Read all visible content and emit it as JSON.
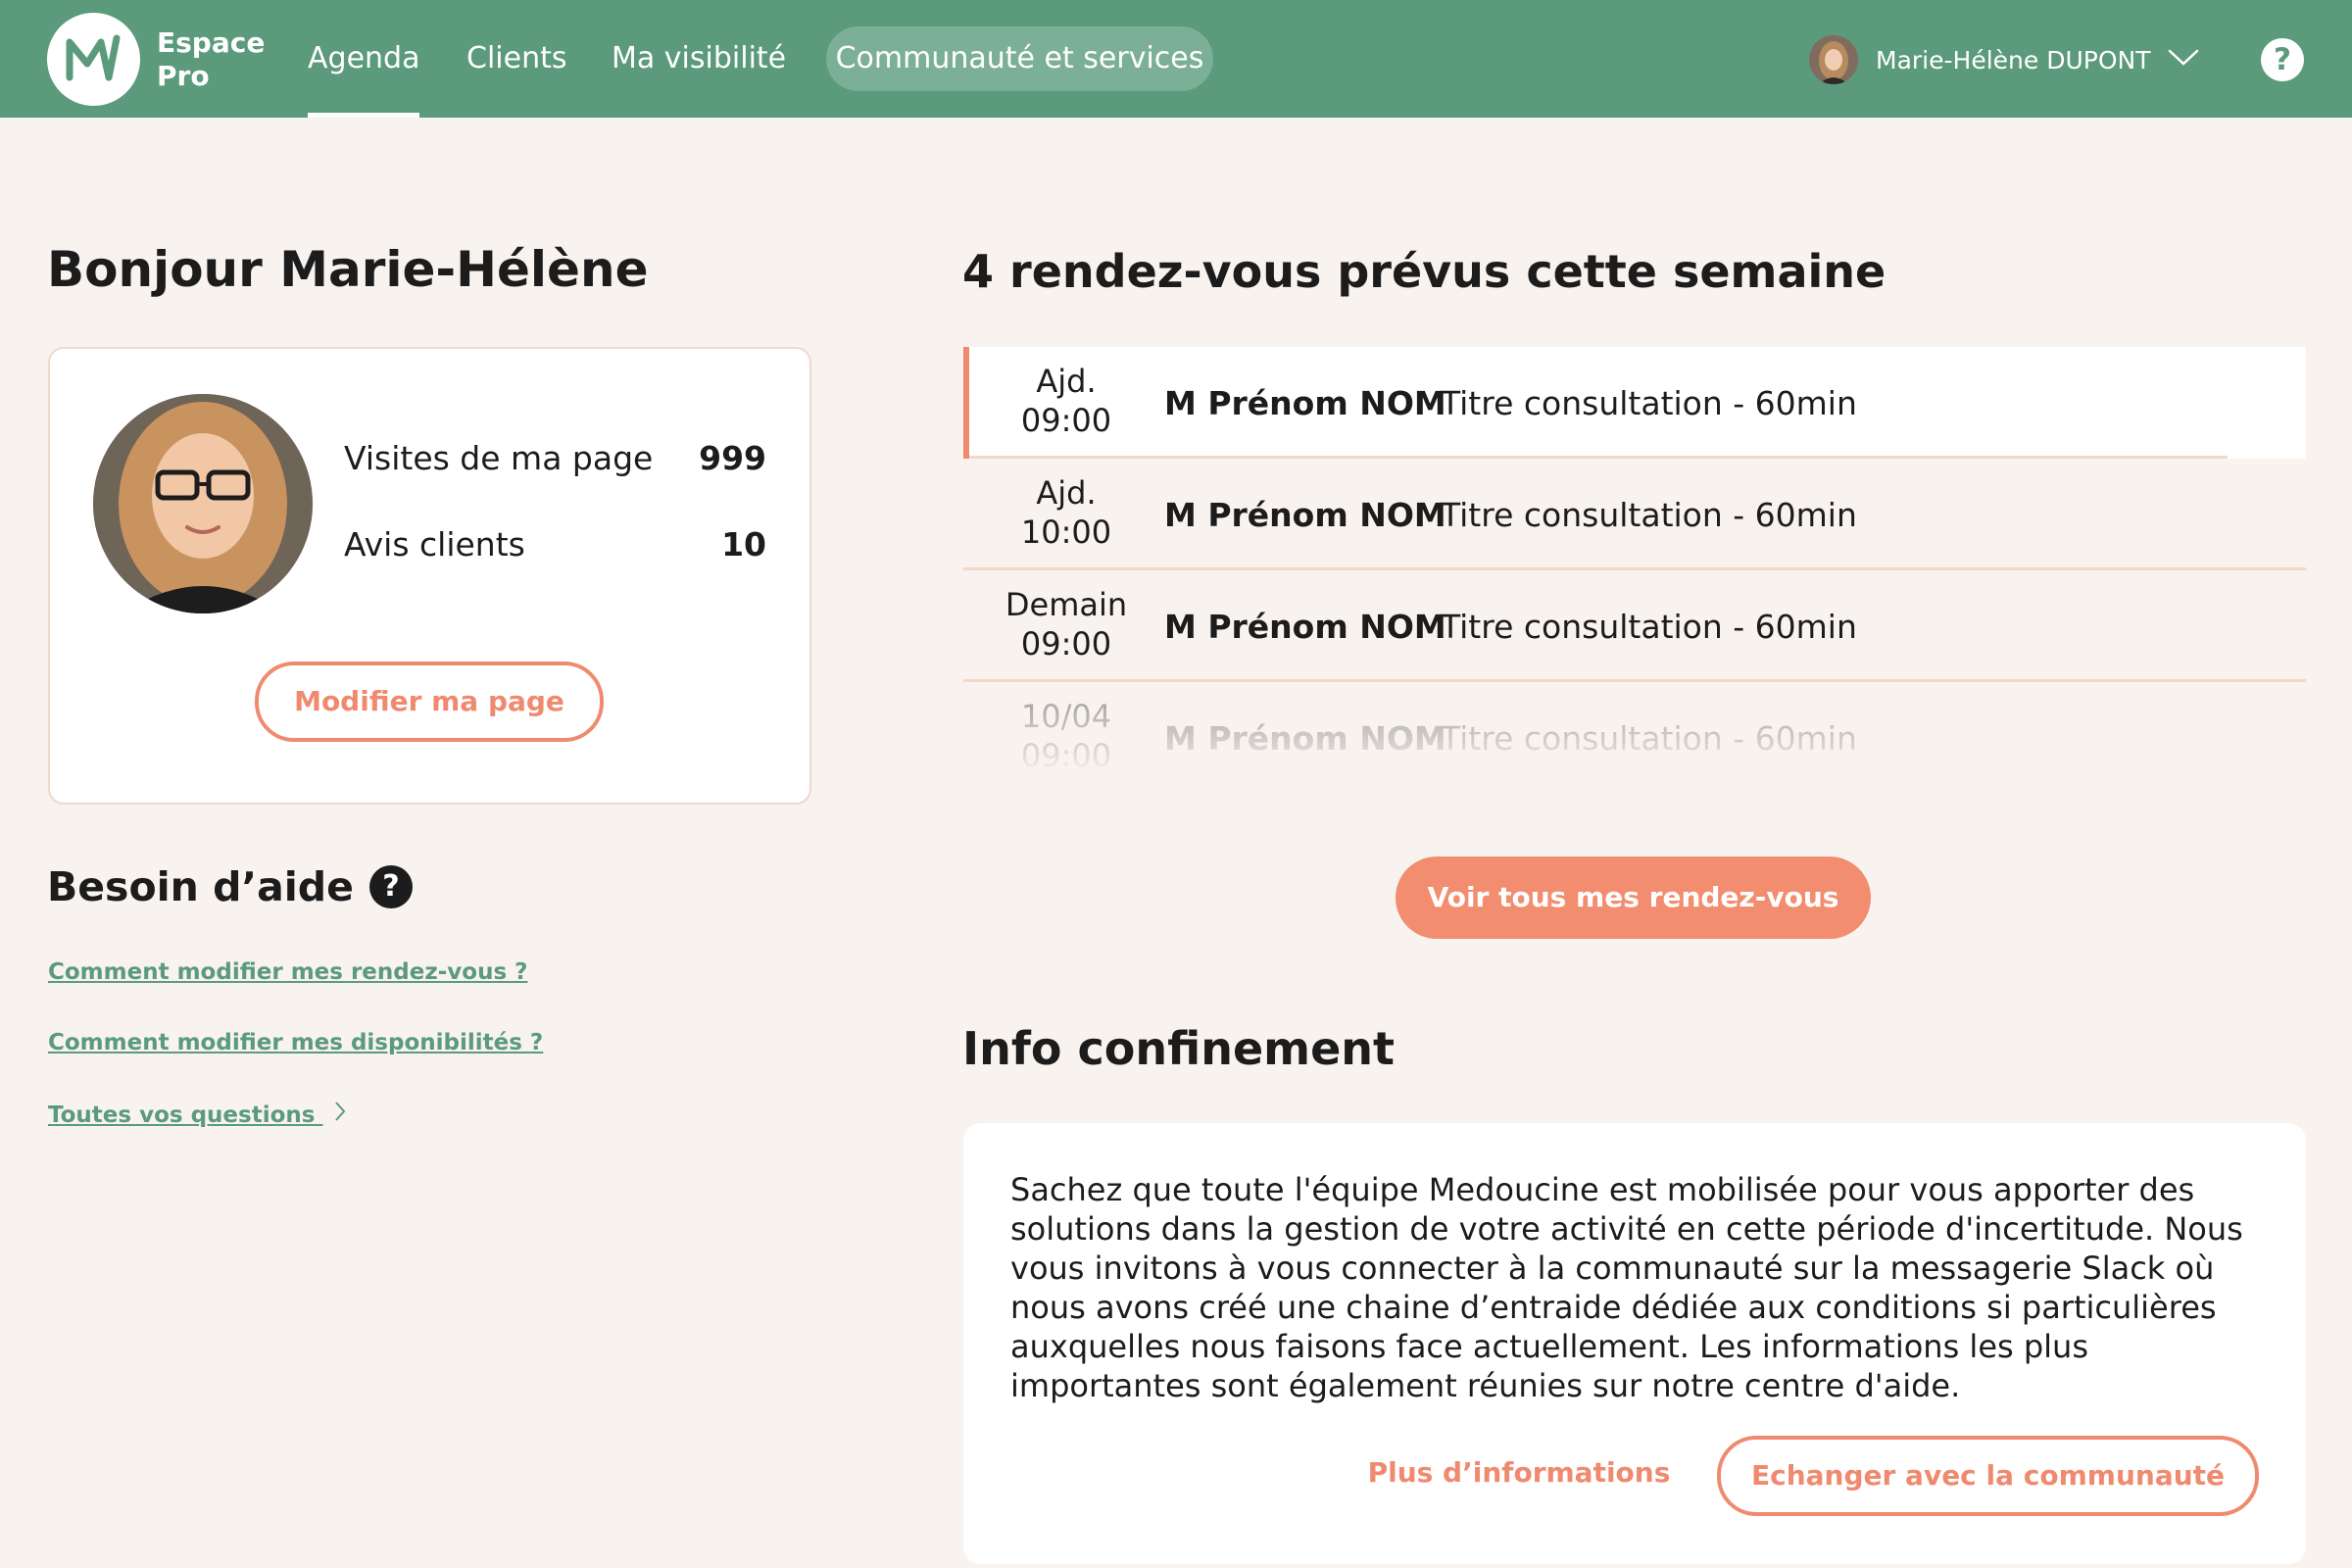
{
  "colors": {
    "brand_green": "#5b9a7b",
    "accent_coral": "#ef8a6f",
    "background": "#f8f3ef"
  },
  "header": {
    "brand_line1": "Espace",
    "brand_line2": "Pro",
    "logo_icon": "medoucine-m-logo",
    "nav": [
      "Agenda",
      "Clients",
      "Ma visibilité",
      "Communauté et services"
    ],
    "active_nav": "Agenda",
    "user_name": "Marie-Hélène DUPONT",
    "help_icon": "?"
  },
  "greeting": "Bonjour Marie-Hélène",
  "profile": {
    "stats": [
      {
        "label": "Visites de ma page",
        "value": "999"
      },
      {
        "label": "Avis clients",
        "value": "10"
      }
    ],
    "edit_button": "Modifier ma page"
  },
  "help": {
    "title": "Besoin d’aide",
    "icon": "?",
    "links": [
      "Comment modifier mes rendez-vous ?",
      "Comment modifier mes disponibilités ?",
      "Toutes vos questions"
    ]
  },
  "appointments": {
    "title": "4 rendez-vous prévus cette semaine",
    "items": [
      {
        "day": "Ajd.",
        "time": "09:00",
        "name": "M Prénom NOM",
        "title": "Titre consultation - 60min"
      },
      {
        "day": "Ajd.",
        "time": "10:00",
        "name": "M Prénom NOM",
        "title": "Titre consultation - 60min"
      },
      {
        "day": "Demain",
        "time": "09:00",
        "name": "M Prénom NOM",
        "title": "Titre consultation - 60min"
      },
      {
        "day": "10/04",
        "time": "09:00",
        "name": "M Prénom NOM",
        "title": "Titre consultation - 60min"
      }
    ],
    "button": "Voir tous mes rendez-vous"
  },
  "info": {
    "title": "Info confinement",
    "text": "Sachez que toute l'équipe Medoucine est mobilisée pour vous apporter des solutions dans la gestion de votre activité en cette période d'incertitude. Nous vous invitons à vous connecter à la communauté sur la messagerie Slack où nous avons créé une chaine d’entraide dédiée aux conditions si particulières auxquelles nous faisons face actuellement. Les informations les plus importantes sont également réunies sur notre centre d'aide.",
    "more_link": "Plus d’informations",
    "community_button": "Echanger avec la communauté"
  }
}
